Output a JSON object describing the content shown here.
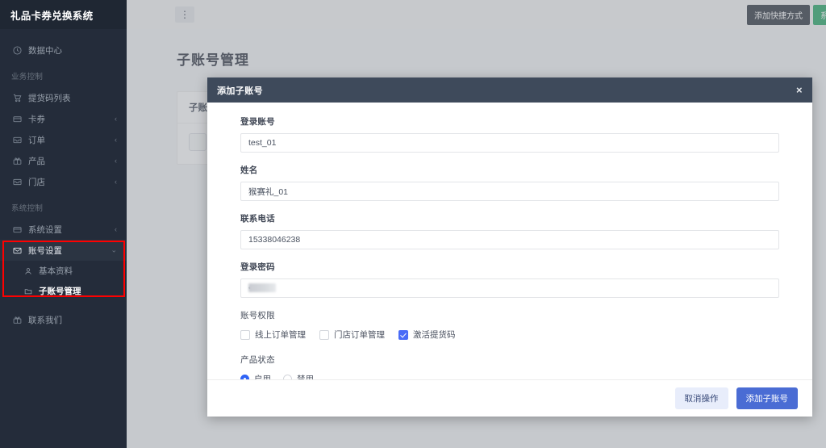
{
  "sidebar": {
    "brand": "礼品卡券兑换系统",
    "items": [
      {
        "label": "数据中心",
        "icon": "clock-icon",
        "caret": false
      },
      {
        "label": "提货码列表",
        "icon": "cart-icon",
        "caret": false
      },
      {
        "label": "卡券",
        "icon": "card-icon",
        "caret": true
      },
      {
        "label": "订单",
        "icon": "inbox-icon",
        "caret": true
      },
      {
        "label": "产品",
        "icon": "gift-icon",
        "caret": true
      },
      {
        "label": "门店",
        "icon": "shop-icon",
        "caret": true
      },
      {
        "label": "系统设置",
        "icon": "settings-icon",
        "caret": true
      },
      {
        "label": "账号设置",
        "icon": "account-icon",
        "caret": true
      },
      {
        "label": "联系我们",
        "icon": "contact-icon",
        "caret": false
      }
    ],
    "groups": {
      "business": "业务控制",
      "system": "系统控制"
    },
    "submenu": [
      {
        "label": "基本资料",
        "icon": "user-icon",
        "active": false
      },
      {
        "label": "子账号管理",
        "icon": "folder-icon",
        "active": true
      }
    ],
    "highlight_color": "#ff0000"
  },
  "topbar": {
    "menu_icon": "vertical-ellipsis-icon",
    "shortcut_button": "添加快捷方式",
    "system_button": "系统"
  },
  "page": {
    "title": "子账号管理",
    "card_title": "子账号"
  },
  "modal": {
    "title": "添加子账号",
    "close_icon": "close-icon",
    "fields": {
      "account_label": "登录账号",
      "account_value": "test_01",
      "name_label": "姓名",
      "name_value": "猴赛礼_01",
      "phone_label": "联系电话",
      "phone_value": "15338046238",
      "password_label": "登录密码",
      "password_value": "••••••"
    },
    "permissions": {
      "label": "账号权限",
      "options": [
        {
          "label": "线上订单管理",
          "checked": false
        },
        {
          "label": "门店订单管理",
          "checked": false
        },
        {
          "label": "激活提货码",
          "checked": true
        }
      ]
    },
    "status": {
      "label": "产品状态",
      "options": [
        {
          "label": "启用",
          "selected": true
        },
        {
          "label": "禁用",
          "selected": false
        }
      ]
    },
    "footer": {
      "cancel_label": "取消操作",
      "submit_label": "添加子账号"
    },
    "accent_color": "#4a6cd4",
    "header_color": "#3e4a5b"
  }
}
